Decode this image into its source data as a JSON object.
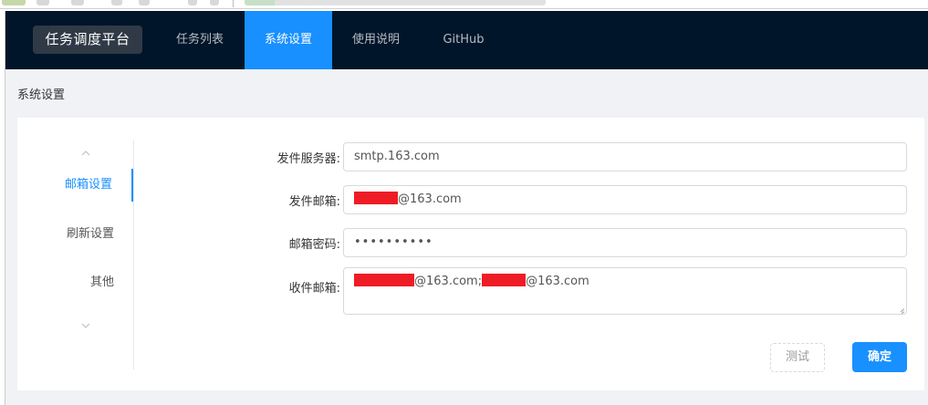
{
  "topnav": {
    "brand": "任务调度平台",
    "items": [
      {
        "label": "任务列表",
        "active": false
      },
      {
        "label": "系统设置",
        "active": true
      },
      {
        "label": "使用说明",
        "active": false
      },
      {
        "label": "GitHub",
        "active": false
      }
    ]
  },
  "page": {
    "title": "系统设置"
  },
  "vtabs": {
    "up_icon": "chevron-up-icon",
    "down_icon": "chevron-down-icon",
    "items": [
      {
        "label": "邮箱设置",
        "active": true
      },
      {
        "label": "刷新设置",
        "active": false
      },
      {
        "label": "其他",
        "active": false
      }
    ]
  },
  "form": {
    "smtp_label": "发件服务器:",
    "smtp_value": "smtp.163.com",
    "sender_label": "发件邮箱:",
    "sender_suffix": "@163.com",
    "password_label": "邮箱密码:",
    "password_mask": "••••••••••",
    "recipients_label": "收件邮箱:",
    "recipients_suffix_1": "@163.com;",
    "recipients_suffix_2": "@163.com"
  },
  "buttons": {
    "test": "测试",
    "ok": "确定"
  },
  "colors": {
    "nav_bg": "#001529",
    "accent": "#1890ff",
    "redaction": "#ee1c25"
  }
}
